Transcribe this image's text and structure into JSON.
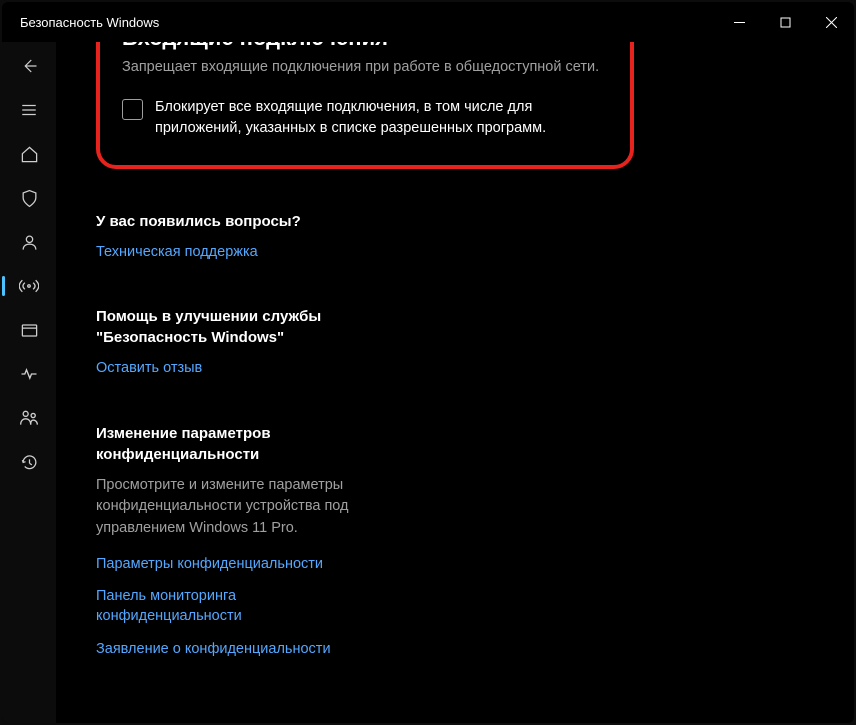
{
  "window": {
    "title": "Безопасность Windows"
  },
  "sidebar": {
    "items": [
      {
        "name": "back"
      },
      {
        "name": "menu"
      },
      {
        "name": "home"
      },
      {
        "name": "virus"
      },
      {
        "name": "account"
      },
      {
        "name": "firewall",
        "active": true
      },
      {
        "name": "app-browser"
      },
      {
        "name": "device-health"
      },
      {
        "name": "family"
      },
      {
        "name": "history"
      }
    ]
  },
  "incoming": {
    "heading": "Входящие подключения",
    "description": "Запрещает входящие подключения при работе в общедоступной сети.",
    "checkbox_label": "Блокирует все входящие подключения, в том числе для приложений, указанных в списке разрешенных программ.",
    "checked": false
  },
  "questions": {
    "heading": "У вас появились вопросы?",
    "link": "Техническая поддержка"
  },
  "feedback": {
    "heading": "Помощь в улучшении службы \"Безопасность Windows\"",
    "link": "Оставить отзыв"
  },
  "privacy": {
    "heading": "Изменение параметров конфиденциальности",
    "body": "Просмотрите и измените параметры конфиденциальности устройства под управлением Windows 11 Pro.",
    "links": [
      "Параметры конфиденциальности",
      "Панель мониторинга конфиденциальности",
      "Заявление о конфиденциальности"
    ]
  }
}
